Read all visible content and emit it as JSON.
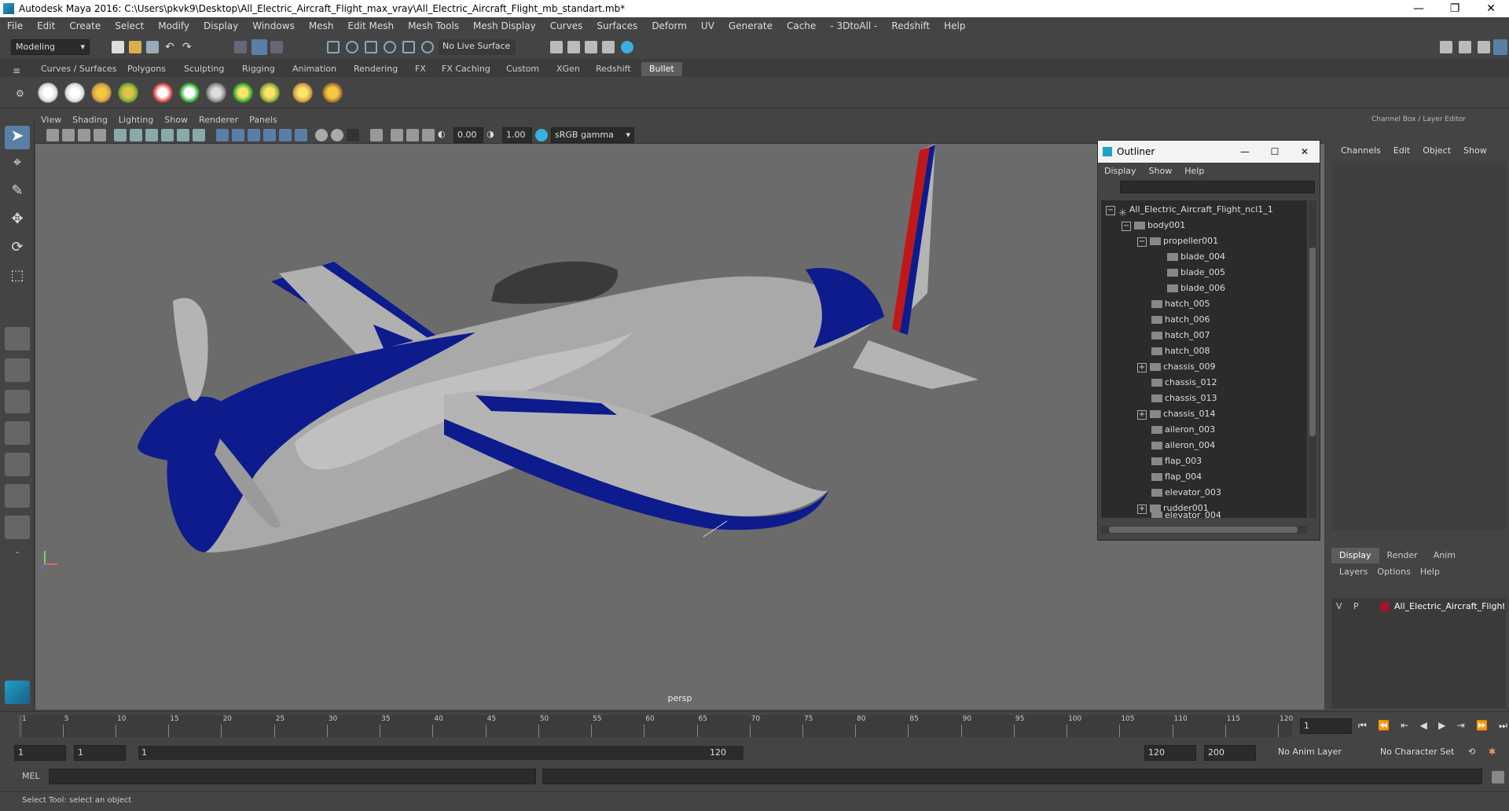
{
  "window": {
    "title": "Autodesk Maya 2016: C:\\Users\\pkvk9\\Desktop\\All_Electric_Aircraft_Flight_max_vray\\All_Electric_Aircraft_Flight_mb_standart.mb*",
    "minimize": "—",
    "maximize": "❐",
    "close": "✕"
  },
  "menubar": [
    "File",
    "Edit",
    "Create",
    "Select",
    "Modify",
    "Display",
    "Windows",
    "Mesh",
    "Edit Mesh",
    "Mesh Tools",
    "Mesh Display",
    "Curves",
    "Surfaces",
    "Deform",
    "UV",
    "Generate",
    "Cache",
    "- 3DtoAll -",
    "Redshift",
    "Help"
  ],
  "statusline": {
    "mode": "Modeling",
    "live_surface": "No Live Surface"
  },
  "shelf_tabs": [
    "Curves / Surfaces",
    "Polygons",
    "Sculpting",
    "Rigging",
    "Animation",
    "Rendering",
    "FX",
    "FX Caching",
    "Custom",
    "XGen",
    "Redshift",
    "Bullet"
  ],
  "shelf_active": "Bullet",
  "viewport": {
    "menu": [
      "View",
      "Shading",
      "Lighting",
      "Show",
      "Renderer",
      "Panels"
    ],
    "exposure": "0.00",
    "gamma": "1.00",
    "color_space": "sRGB gamma",
    "camera_label": "persp"
  },
  "outliner": {
    "title": "Outliner",
    "menu": [
      "Display",
      "Show",
      "Help"
    ],
    "items": [
      {
        "label": "All_Electric_Aircraft_Flight_ncl1_1",
        "depth": 0,
        "expander": "−"
      },
      {
        "label": "body001",
        "depth": 1,
        "expander": "−"
      },
      {
        "label": "propeller001",
        "depth": 2,
        "expander": "−"
      },
      {
        "label": "blade_004",
        "depth": 3,
        "expander": ""
      },
      {
        "label": "blade_005",
        "depth": 3,
        "expander": ""
      },
      {
        "label": "blade_006",
        "depth": 3,
        "expander": ""
      },
      {
        "label": "hatch_005",
        "depth": 2,
        "expander": ""
      },
      {
        "label": "hatch_006",
        "depth": 2,
        "expander": ""
      },
      {
        "label": "hatch_007",
        "depth": 2,
        "expander": ""
      },
      {
        "label": "hatch_008",
        "depth": 2,
        "expander": ""
      },
      {
        "label": "chassis_009",
        "depth": 2,
        "expander": "+"
      },
      {
        "label": "chassis_012",
        "depth": 2,
        "expander": ""
      },
      {
        "label": "chassis_013",
        "depth": 2,
        "expander": ""
      },
      {
        "label": "chassis_014",
        "depth": 2,
        "expander": "+"
      },
      {
        "label": "aileron_003",
        "depth": 2,
        "expander": ""
      },
      {
        "label": "aileron_004",
        "depth": 2,
        "expander": ""
      },
      {
        "label": "flap_003",
        "depth": 2,
        "expander": ""
      },
      {
        "label": "flap_004",
        "depth": 2,
        "expander": ""
      },
      {
        "label": "elevator_003",
        "depth": 2,
        "expander": ""
      },
      {
        "label": "rudder001",
        "depth": 2,
        "expander": "+"
      },
      {
        "label": "elevator_004",
        "depth": 2,
        "expander": ""
      }
    ]
  },
  "channelbox": {
    "title": "Channel Box / Layer Editor",
    "menu": [
      "Channels",
      "Edit",
      "Object",
      "Show"
    ]
  },
  "layer_editor": {
    "tabs": [
      "Display",
      "Render",
      "Anim"
    ],
    "active_tab": "Display",
    "menu": [
      "Layers",
      "Options",
      "Help"
    ],
    "layer": {
      "v": "V",
      "p": "P",
      "name": "All_Electric_Aircraft_Flight",
      "color": "#a0142e"
    }
  },
  "timeline": {
    "ticks": [
      "1",
      "5",
      "10",
      "15",
      "20",
      "25",
      "30",
      "35",
      "40",
      "45",
      "50",
      "55",
      "60",
      "65",
      "70",
      "75",
      "80",
      "85",
      "90",
      "95",
      "100",
      "105",
      "110",
      "115",
      "120"
    ],
    "current_frame": "1"
  },
  "range": {
    "start": "1",
    "playback_start": "1",
    "slider_start": "1",
    "slider_end": "120",
    "playback_end": "120",
    "end": "200",
    "anim_layer": "No Anim Layer",
    "character_set": "No Character Set"
  },
  "cmdline": {
    "label": "MEL"
  },
  "helpline": {
    "text": "Select Tool: select an object"
  },
  "colors": {
    "plane_blue": "#0d1b8c",
    "plane_gray": "#a9a9a9",
    "viewport_bg": "#6b6b6b",
    "rudder_red": "#c01818"
  }
}
